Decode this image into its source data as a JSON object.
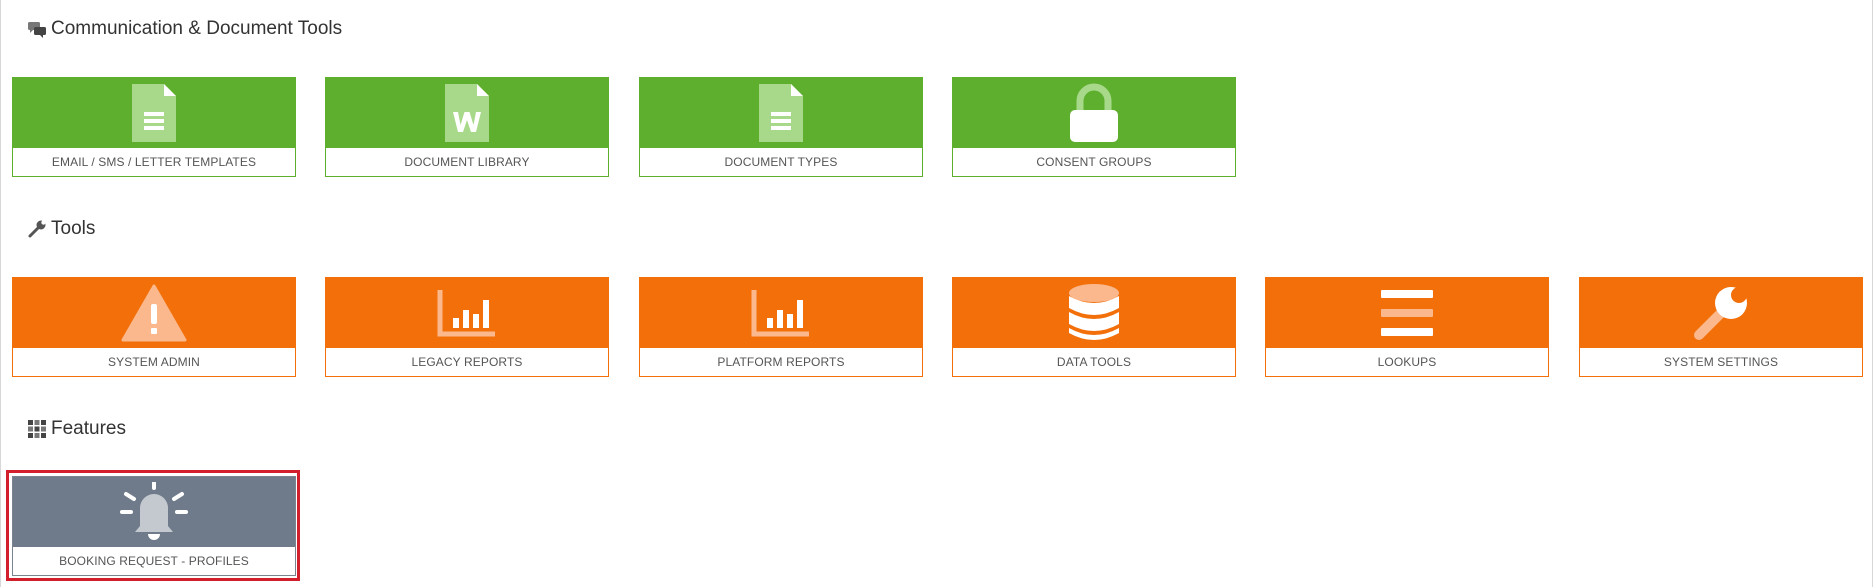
{
  "sections": {
    "communication": {
      "title": "Communication & Document Tools",
      "icon": "chat-bubbles-icon"
    },
    "tools": {
      "title": "Tools",
      "icon": "wrench-icon"
    },
    "features": {
      "title": "Features",
      "icon": "grid-icon"
    }
  },
  "tiles": {
    "email_templates": {
      "label": "EMAIL / SMS / LETTER TEMPLATES",
      "icon": "document-lines-icon"
    },
    "document_library": {
      "label": "DOCUMENT LIBRARY",
      "icon": "word-document-icon"
    },
    "document_types": {
      "label": "DOCUMENT TYPES",
      "icon": "document-lines-icon"
    },
    "consent_groups": {
      "label": "CONSENT GROUPS",
      "icon": "lock-icon"
    },
    "system_admin": {
      "label": "SYSTEM ADMIN",
      "icon": "warning-icon"
    },
    "legacy_reports": {
      "label": "LEGACY REPORTS",
      "icon": "bar-chart-icon"
    },
    "platform_reports": {
      "label": "PLATFORM REPORTS",
      "icon": "bar-chart-icon"
    },
    "data_tools": {
      "label": "DATA TOOLS",
      "icon": "database-icon"
    },
    "lookups": {
      "label": "LOOKUPS",
      "icon": "list-icon"
    },
    "system_settings": {
      "label": "SYSTEM SETTINGS",
      "icon": "wrench-icon"
    },
    "booking_request": {
      "label": "BOOKING REQUEST - PROFILES",
      "icon": "bell-icon"
    }
  },
  "colors": {
    "green": "#5eaf2e",
    "orange": "#f26f0a",
    "gray": "#6f7b8a",
    "selected_outline": "#d31f2b"
  }
}
